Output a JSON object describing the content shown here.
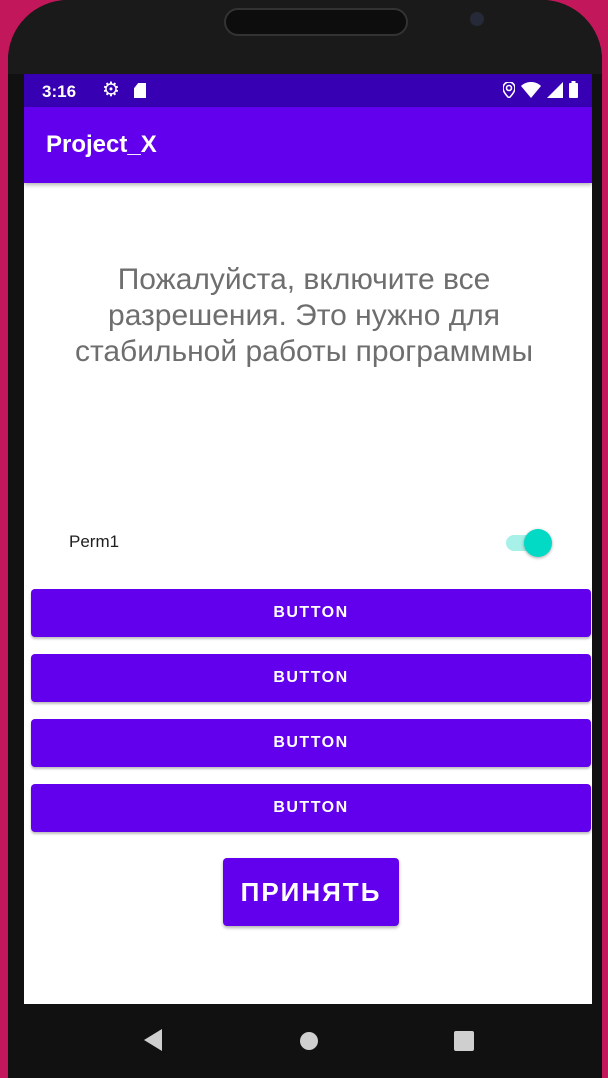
{
  "status_bar": {
    "time": "3:16",
    "icons": [
      "gear-icon",
      "sd-card-icon",
      "location-icon",
      "wifi-icon",
      "signal-icon",
      "battery-icon"
    ]
  },
  "app_bar": {
    "title": "Project_X"
  },
  "main": {
    "message": "Пожалуйста, включите все разрешения. Это нужно для стабильной работы программмы",
    "permission": {
      "label": "Perm1",
      "enabled": true
    },
    "buttons": [
      {
        "label": "BUTTON"
      },
      {
        "label": "BUTTON"
      },
      {
        "label": "BUTTON"
      },
      {
        "label": "BUTTON"
      }
    ],
    "accept_label": "ПРИНЯТЬ"
  },
  "nav_bar": {
    "icons": [
      "back-icon",
      "home-icon",
      "recents-icon"
    ]
  },
  "colors": {
    "primary": "#6200ee",
    "primary_dark": "#3700b3",
    "accent": "#03dac5",
    "background": "#c2185b"
  }
}
